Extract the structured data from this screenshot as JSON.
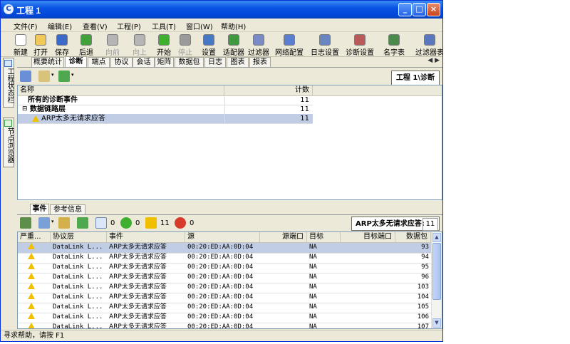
{
  "window": {
    "title": "工程 1",
    "min": "_",
    "max": "□",
    "close": "×",
    "app_icon": "C"
  },
  "menu": [
    "文件(F)",
    "编辑(E)",
    "查看(V)",
    "工程(P)",
    "工具(T)",
    "窗口(W)",
    "帮助(H)"
  ],
  "toolbar": [
    {
      "label": "新建",
      "icon": "new-file-icon",
      "color": "#ffffff",
      "enabled": true
    },
    {
      "label": "打开",
      "icon": "open-folder-icon",
      "color": "#f1c85a",
      "enabled": true
    },
    {
      "label": "保存",
      "icon": "save-icon",
      "color": "#3a6ac8",
      "enabled": true
    },
    {
      "label": "后退",
      "icon": "back-arrow-icon",
      "color": "#3fa33a",
      "enabled": true
    },
    {
      "label": "向前",
      "icon": "forward-arrow-icon",
      "color": "#b5b5b5",
      "enabled": false
    },
    {
      "label": "向上",
      "icon": "up-arrow-icon",
      "color": "#b5b5b5",
      "enabled": false
    },
    {
      "label": "开始",
      "icon": "start-icon",
      "color": "#3faf30",
      "enabled": true
    },
    {
      "label": "停止",
      "icon": "stop-icon",
      "color": "#9a9a9a",
      "enabled": false
    },
    {
      "label": "设置",
      "icon": "settings-icon",
      "color": "#4778c4",
      "enabled": true
    },
    {
      "label": "适配器",
      "icon": "adapter-icon",
      "color": "#3f9a3f",
      "enabled": true
    },
    {
      "label": "过滤器",
      "icon": "filter-icon",
      "color": "#7a8ac8",
      "enabled": true
    },
    {
      "label": "网络配置",
      "icon": "network-config-icon",
      "color": "#5a7ed0",
      "enabled": true
    },
    {
      "label": "日志设置",
      "icon": "log-settings-icon",
      "color": "#6a86c2",
      "enabled": true
    },
    {
      "label": "诊断设置",
      "icon": "diagnosis-settings-icon",
      "color": "#b95a5a",
      "enabled": true
    },
    {
      "label": "名字表",
      "icon": "name-table-icon",
      "color": "#4a8a4a",
      "enabled": true
    },
    {
      "label": "过滤器表",
      "icon": "filter-table-icon",
      "color": "#5a78c0",
      "enabled": true
    }
  ],
  "side_tabs": [
    {
      "label": "工程状态栏",
      "icon": "project-status-icon"
    },
    {
      "label": "节点浏览器",
      "icon": "node-browser-icon"
    }
  ],
  "tabs": [
    "概要统计",
    "诊断",
    "端点",
    "协议",
    "会话",
    "矩阵",
    "数据包",
    "日志",
    "图表",
    "报表"
  ],
  "active_tab": "诊断",
  "tab_scroll": "◀ ▶",
  "view_title": "工程 1\\诊断",
  "upper_table": {
    "headers": [
      "名称",
      "计数"
    ],
    "rows": [
      {
        "label": "所有的诊断事件",
        "count": "11",
        "bold": true
      },
      {
        "label": "数据链路层",
        "count": "11",
        "bold": true,
        "expander": "⊟"
      },
      {
        "label": "ARP太多无请求应答",
        "count": "11",
        "bold": false,
        "warning": true,
        "selected": true
      }
    ]
  },
  "bottom_tabs": [
    "事件",
    "参考信息"
  ],
  "active_bottom_tab": "事件",
  "event_counts": {
    "info": "0",
    "notice": "0",
    "warning": "11",
    "error": "0"
  },
  "event_box": {
    "label": "ARP太多无请求应答:",
    "value": "11"
  },
  "lower_table": {
    "headers": [
      "严重...",
      "协议层",
      "事件",
      "源",
      "源端口",
      "目标",
      "目标端口",
      "数据包"
    ],
    "rows": [
      {
        "layer": "DataLink L...",
        "event": "ARP太多无请求应答",
        "source": "00:20:ED:AA:0D:04",
        "src_port": "",
        "target": "NA",
        "dst_port": "",
        "packet": "93",
        "selected": true
      },
      {
        "layer": "DataLink L...",
        "event": "ARP太多无请求应答",
        "source": "00:20:ED:AA:0D:04",
        "src_port": "",
        "target": "NA",
        "dst_port": "",
        "packet": "94",
        "selected": false
      },
      {
        "layer": "DataLink L...",
        "event": "ARP太多无请求应答",
        "source": "00:20:ED:AA:0D:04",
        "src_port": "",
        "target": "NA",
        "dst_port": "",
        "packet": "95",
        "selected": false
      },
      {
        "layer": "DataLink L...",
        "event": "ARP太多无请求应答",
        "source": "00:20:ED:AA:0D:04",
        "src_port": "",
        "target": "NA",
        "dst_port": "",
        "packet": "96",
        "selected": false
      },
      {
        "layer": "DataLink L...",
        "event": "ARP太多无请求应答",
        "source": "00:20:ED:AA:0D:04",
        "src_port": "",
        "target": "NA",
        "dst_port": "",
        "packet": "103",
        "selected": false
      },
      {
        "layer": "DataLink L...",
        "event": "ARP太多无请求应答",
        "source": "00:20:ED:AA:0D:04",
        "src_port": "",
        "target": "NA",
        "dst_port": "",
        "packet": "104",
        "selected": false
      },
      {
        "layer": "DataLink L...",
        "event": "ARP太多无请求应答",
        "source": "00:20:ED:AA:0D:04",
        "src_port": "",
        "target": "NA",
        "dst_port": "",
        "packet": "105",
        "selected": false
      },
      {
        "layer": "DataLink L...",
        "event": "ARP太多无请求应答",
        "source": "00:20:ED:AA:0D:04",
        "src_port": "",
        "target": "NA",
        "dst_port": "",
        "packet": "106",
        "selected": false
      },
      {
        "layer": "DataLink L...",
        "event": "ARP太多无请求应答",
        "source": "00:20:ED:AA:0D:04",
        "src_port": "",
        "target": "NA",
        "dst_port": "",
        "packet": "107",
        "selected": false
      }
    ]
  },
  "scroll_arrows": {
    "up": "▲",
    "down": "▼"
  },
  "status": "寻求帮助，请按 F1"
}
